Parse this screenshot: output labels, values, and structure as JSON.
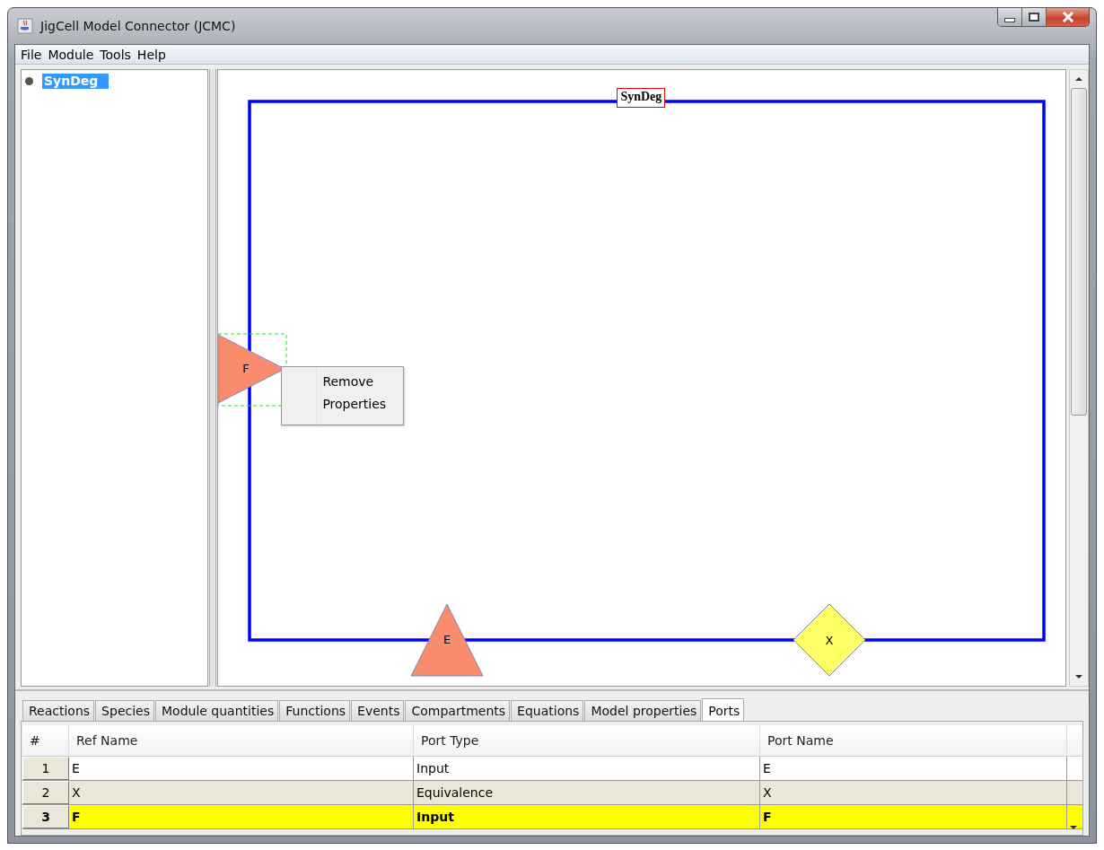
{
  "window": {
    "title": "JigCell Model Connector (JCMC)"
  },
  "menu": [
    "File",
    "Module",
    "Tools",
    "Help"
  ],
  "tree": {
    "items": [
      {
        "label": "SynDeg",
        "selected": true
      }
    ]
  },
  "diagram": {
    "module": "SynDeg",
    "nodes": [
      {
        "label": "F",
        "kind": "input",
        "selected": true
      },
      {
        "label": "E",
        "kind": "input",
        "selected": false
      },
      {
        "label": "X",
        "kind": "equivalence",
        "selected": false
      }
    ],
    "context_menu": [
      "Remove",
      "Properties"
    ]
  },
  "tabs": [
    {
      "label": "Reactions",
      "selected": false
    },
    {
      "label": "Species",
      "selected": false
    },
    {
      "label": "Module quantities",
      "selected": false
    },
    {
      "label": "Functions",
      "selected": false
    },
    {
      "label": "Events",
      "selected": false
    },
    {
      "label": "Compartments",
      "selected": false
    },
    {
      "label": "Equations",
      "selected": false
    },
    {
      "label": "Model properties",
      "selected": false
    },
    {
      "label": "Ports",
      "selected": true
    }
  ],
  "table": {
    "columns": [
      "#",
      "Ref Name",
      "Port Type",
      "Port Name"
    ],
    "rows": [
      {
        "cells": [
          "1",
          "E",
          "Input",
          "E"
        ],
        "selected": false
      },
      {
        "cells": [
          "2",
          "X",
          "Equivalence",
          "X"
        ],
        "selected": false
      },
      {
        "cells": [
          "3",
          "F",
          "Input",
          "F"
        ],
        "selected": true
      }
    ]
  }
}
